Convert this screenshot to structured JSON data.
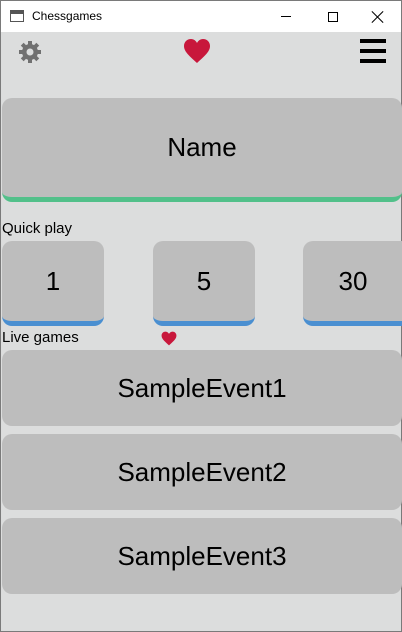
{
  "window": {
    "title": "Chessgames"
  },
  "toolbar": {
    "settings_icon": "gear-icon",
    "favorite_icon": "heart-icon",
    "menu_icon": "hamburger-menu-icon",
    "heart_color": "#c8173b",
    "gear_color": "#707070"
  },
  "profile": {
    "name_label": "Name",
    "accent_color": "#52c08a"
  },
  "quick_play": {
    "label": "Quick play",
    "options": [
      "1",
      "5",
      "30"
    ],
    "accent_color": "#4a8fd1"
  },
  "live_games": {
    "label": "Live games",
    "events": [
      "SampleEvent1",
      "SampleEvent2",
      "SampleEvent3"
    ]
  }
}
